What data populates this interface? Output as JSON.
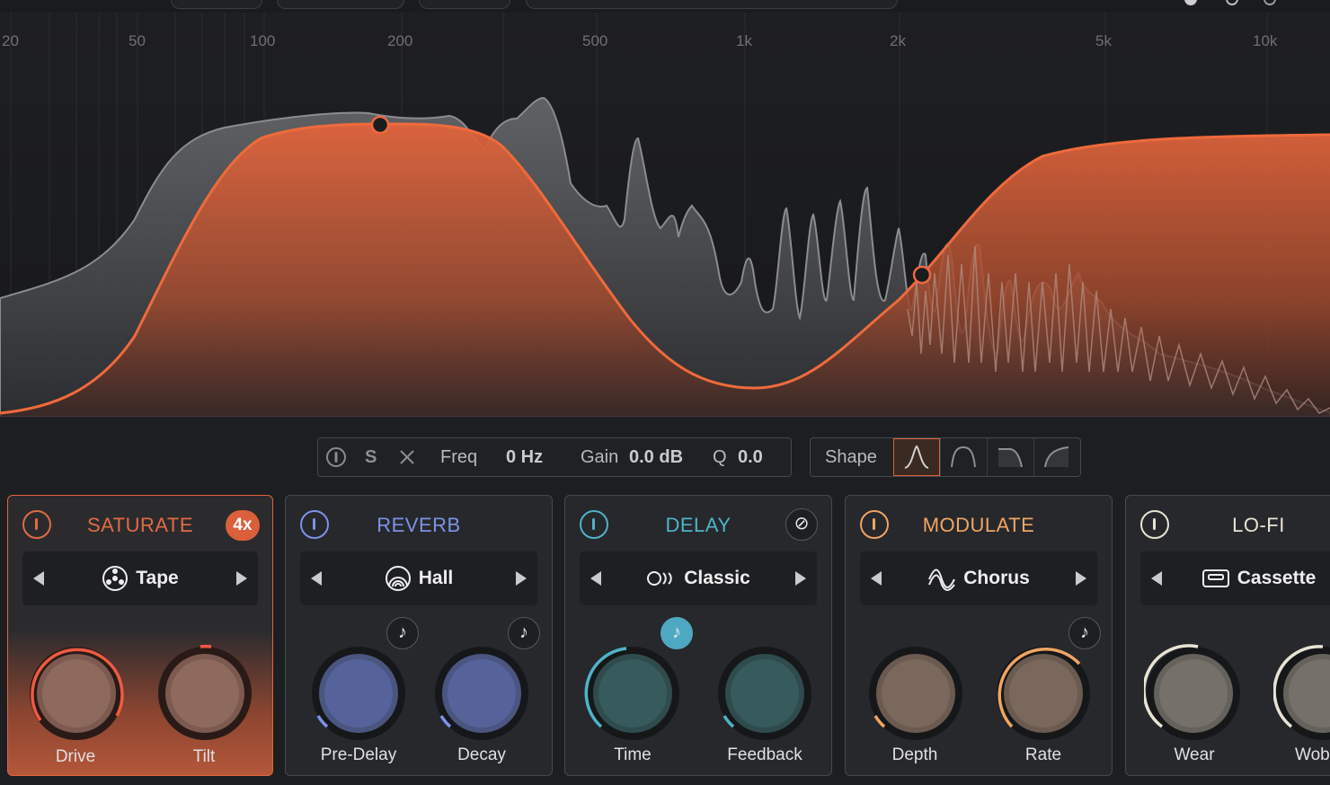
{
  "analyzer": {
    "freq_labels": [
      "20",
      "50",
      "100",
      "200",
      "500",
      "1k",
      "2k",
      "5k",
      "10k"
    ]
  },
  "band": {
    "solo_label": "S",
    "freq_label": "Freq",
    "freq_value": "0 Hz",
    "gain_label": "Gain",
    "gain_value": "0.0 dB",
    "q_label": "Q",
    "q_value": "0.0",
    "shape_label": "Shape",
    "shape_active": "bell"
  },
  "modules": {
    "saturate": {
      "title": "SATURATE",
      "badge": "4x",
      "preset": "Tape",
      "color": "#e26a45",
      "knob1": "Drive",
      "knob2": "Tilt"
    },
    "reverb": {
      "title": "REVERB",
      "preset": "Hall",
      "color": "#7d92e8",
      "knob1": "Pre-Delay",
      "knob2": "Decay"
    },
    "delay": {
      "title": "DELAY",
      "preset": "Classic",
      "color": "#4fb3c8",
      "knob1": "Time",
      "knob2": "Feedback"
    },
    "modulate": {
      "title": "MODULATE",
      "preset": "Chorus",
      "color": "#f0a562",
      "knob1": "Depth",
      "knob2": "Rate"
    },
    "lofi": {
      "title": "LO-FI",
      "preset": "Cassette",
      "color": "#e8e3d3",
      "knob1": "Wear",
      "knob2": "Wobb"
    }
  }
}
